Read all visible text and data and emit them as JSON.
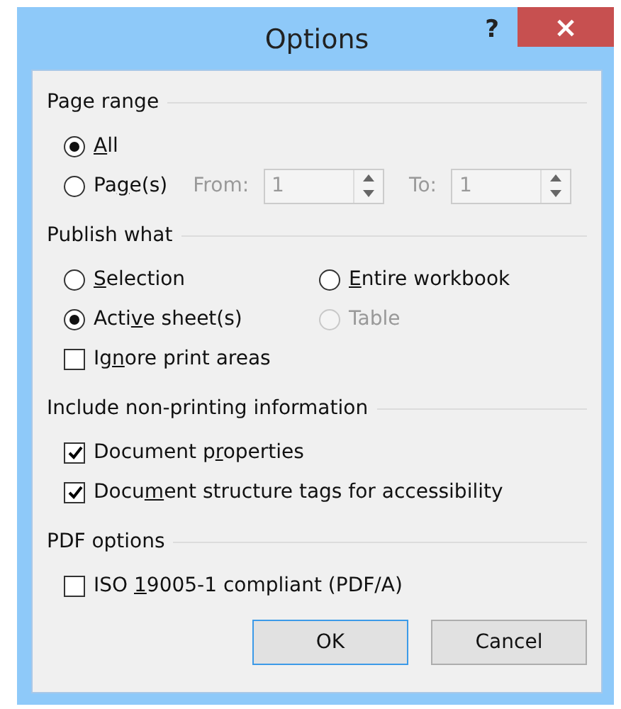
{
  "window": {
    "title": "Options",
    "help": "?",
    "close": "×"
  },
  "groups": [
    {
      "title": "Page range",
      "rows": [
        [
          {
            "kind": "radio",
            "label": {
              "key": "A",
              "post": "ll"
            },
            "selected": true,
            "disabled": false
          }
        ],
        [
          {
            "kind": "radio",
            "label": {
              "pre": "Pa",
              "key": "g",
              "post": "e(s)"
            },
            "selected": false,
            "disabled": false,
            "fields": [
              {
                "label": "From:",
                "value": "1",
                "disabled": true
              },
              {
                "label": "To:",
                "value": "1",
                "disabled": true
              }
            ]
          }
        ]
      ]
    },
    {
      "title": "Publish what",
      "rows": [
        [
          {
            "kind": "radio",
            "label": {
              "key": "S",
              "post": "election"
            },
            "selected": false,
            "disabled": false
          },
          {
            "kind": "radio",
            "label": {
              "key": "E",
              "post": "ntire workbook"
            },
            "selected": false,
            "disabled": false
          }
        ],
        [
          {
            "kind": "radio",
            "label": {
              "pre": "Acti",
              "key": "v",
              "post": "e sheet(s)"
            },
            "selected": true,
            "disabled": false
          },
          {
            "kind": "radio",
            "label": {
              "post": "Table"
            },
            "selected": false,
            "disabled": true
          }
        ],
        [
          {
            "kind": "checkbox",
            "label": {
              "pre": "Ig",
              "key": "n",
              "post": "ore print areas"
            },
            "checked": false,
            "disabled": false
          }
        ]
      ]
    },
    {
      "title": "Include non-printing information",
      "rows": [
        [
          {
            "kind": "checkbox",
            "label": {
              "pre": "Document p",
              "key": "r",
              "post": "operties"
            },
            "checked": true,
            "disabled": false
          }
        ],
        [
          {
            "kind": "checkbox",
            "label": {
              "pre": "Docu",
              "key": "m",
              "post": "ent structure tags for accessibility"
            },
            "checked": true,
            "disabled": false
          }
        ]
      ]
    },
    {
      "title": "PDF options",
      "rows": [
        [
          {
            "kind": "checkbox",
            "label": {
              "pre": "ISO ",
              "key": "1",
              "post": "9005-1 compliant (PDF/A)"
            },
            "checked": false,
            "disabled": false
          }
        ]
      ]
    }
  ],
  "buttons": [
    {
      "label": "OK",
      "default": true
    },
    {
      "label": "Cancel",
      "default": false
    }
  ]
}
